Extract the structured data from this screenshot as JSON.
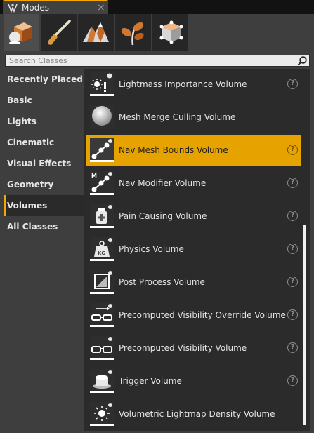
{
  "window": {
    "tab_title": "Modes",
    "close_glyph": "×"
  },
  "mode_buttons": [
    {
      "icon": "place-mode-icon",
      "active": true
    },
    {
      "icon": "paint-mode-icon",
      "active": false
    },
    {
      "icon": "landscape-mode-icon",
      "active": false
    },
    {
      "icon": "foliage-mode-icon",
      "active": false
    },
    {
      "icon": "geometry-edit-mode-icon",
      "active": false
    }
  ],
  "search": {
    "placeholder": "Search Classes",
    "value": ""
  },
  "categories": [
    {
      "label": "Recently Placed",
      "active": false
    },
    {
      "label": "Basic",
      "active": false
    },
    {
      "label": "Lights",
      "active": false
    },
    {
      "label": "Cinematic",
      "active": false
    },
    {
      "label": "Visual Effects",
      "active": false
    },
    {
      "label": "Geometry",
      "active": false
    },
    {
      "label": "Volumes",
      "active": true
    },
    {
      "label": "All Classes",
      "active": false
    }
  ],
  "items": [
    {
      "label": "Lightmass Importance Volume",
      "icon": "lightmass-importance-icon",
      "selected": false,
      "help": "?"
    },
    {
      "label": "Mesh Merge Culling Volume",
      "icon": "sphere-icon",
      "selected": false,
      "help": ""
    },
    {
      "label": "Nav Mesh Bounds Volume",
      "icon": "nav-mesh-icon",
      "selected": true,
      "help": "?"
    },
    {
      "label": "Nav Modifier Volume",
      "icon": "nav-modifier-icon",
      "selected": false,
      "help": "?"
    },
    {
      "label": "Pain Causing Volume",
      "icon": "pain-causing-icon",
      "selected": false,
      "help": "?"
    },
    {
      "label": "Physics Volume",
      "icon": "physics-weight-icon",
      "selected": false,
      "help": "?"
    },
    {
      "label": "Post Process Volume",
      "icon": "post-process-icon",
      "selected": false,
      "help": "?"
    },
    {
      "label": "Precomputed Visibility Override Volume",
      "icon": "visibility-override-icon",
      "selected": false,
      "help": "?"
    },
    {
      "label": "Precomputed Visibility Volume",
      "icon": "visibility-glasses-icon",
      "selected": false,
      "help": "?"
    },
    {
      "label": "Trigger Volume",
      "icon": "trigger-button-icon",
      "selected": false,
      "help": "?"
    },
    {
      "label": "Volumetric Lightmap Density Volume",
      "icon": "lightmap-density-icon",
      "selected": false,
      "help": ""
    }
  ],
  "colors": {
    "accent": "#f2a800",
    "selected_row": "#e6a300",
    "panel": "#3e3e3e",
    "list_bg": "#2b2b2b"
  }
}
